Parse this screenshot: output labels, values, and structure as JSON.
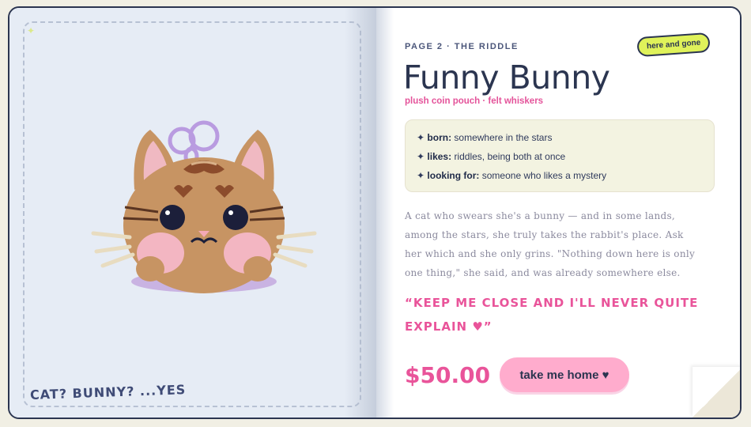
{
  "left_page": {
    "image_alt": "cat-shaped plush coin pouch with bunny ears and purple keyring",
    "caption": "CAT? BUNNY? ...YES"
  },
  "right_page": {
    "page_label": "PAGE 2 · THE RIDDLE",
    "badge": "here and gone",
    "title": "Funny Bunny",
    "subtitle": "plush coin pouch · felt whiskers",
    "facts": [
      {
        "key": "born:",
        "value": "somewhere in the stars"
      },
      {
        "key": "likes:",
        "value": "riddles, being both at once"
      },
      {
        "key": "looking for:",
        "value": "someone who likes a mystery"
      }
    ],
    "story": "A cat who swears she's a bunny — and in some lands, among the stars, she truly takes the rabbit's place. Ask her which and she only grins. \"Nothing down here is only one thing,\" she said, and was already somewhere else.",
    "quote": "“KEEP ME CLOSE AND I'LL NEVER QUITE EXPLAIN ♥”",
    "price": "$50.00",
    "cta": "take me home ♥"
  },
  "colors": {
    "ink": "#2b3550",
    "accent_pink": "#e9549a",
    "button_pink": "#ffaccd",
    "badge_lime": "#dff25a",
    "left_bg": "#e6ecf5",
    "facts_bg": "#f3f3e1"
  },
  "icons": {
    "fact_bullet": "sparkle-icon",
    "badge_decoration": "star-icon"
  }
}
